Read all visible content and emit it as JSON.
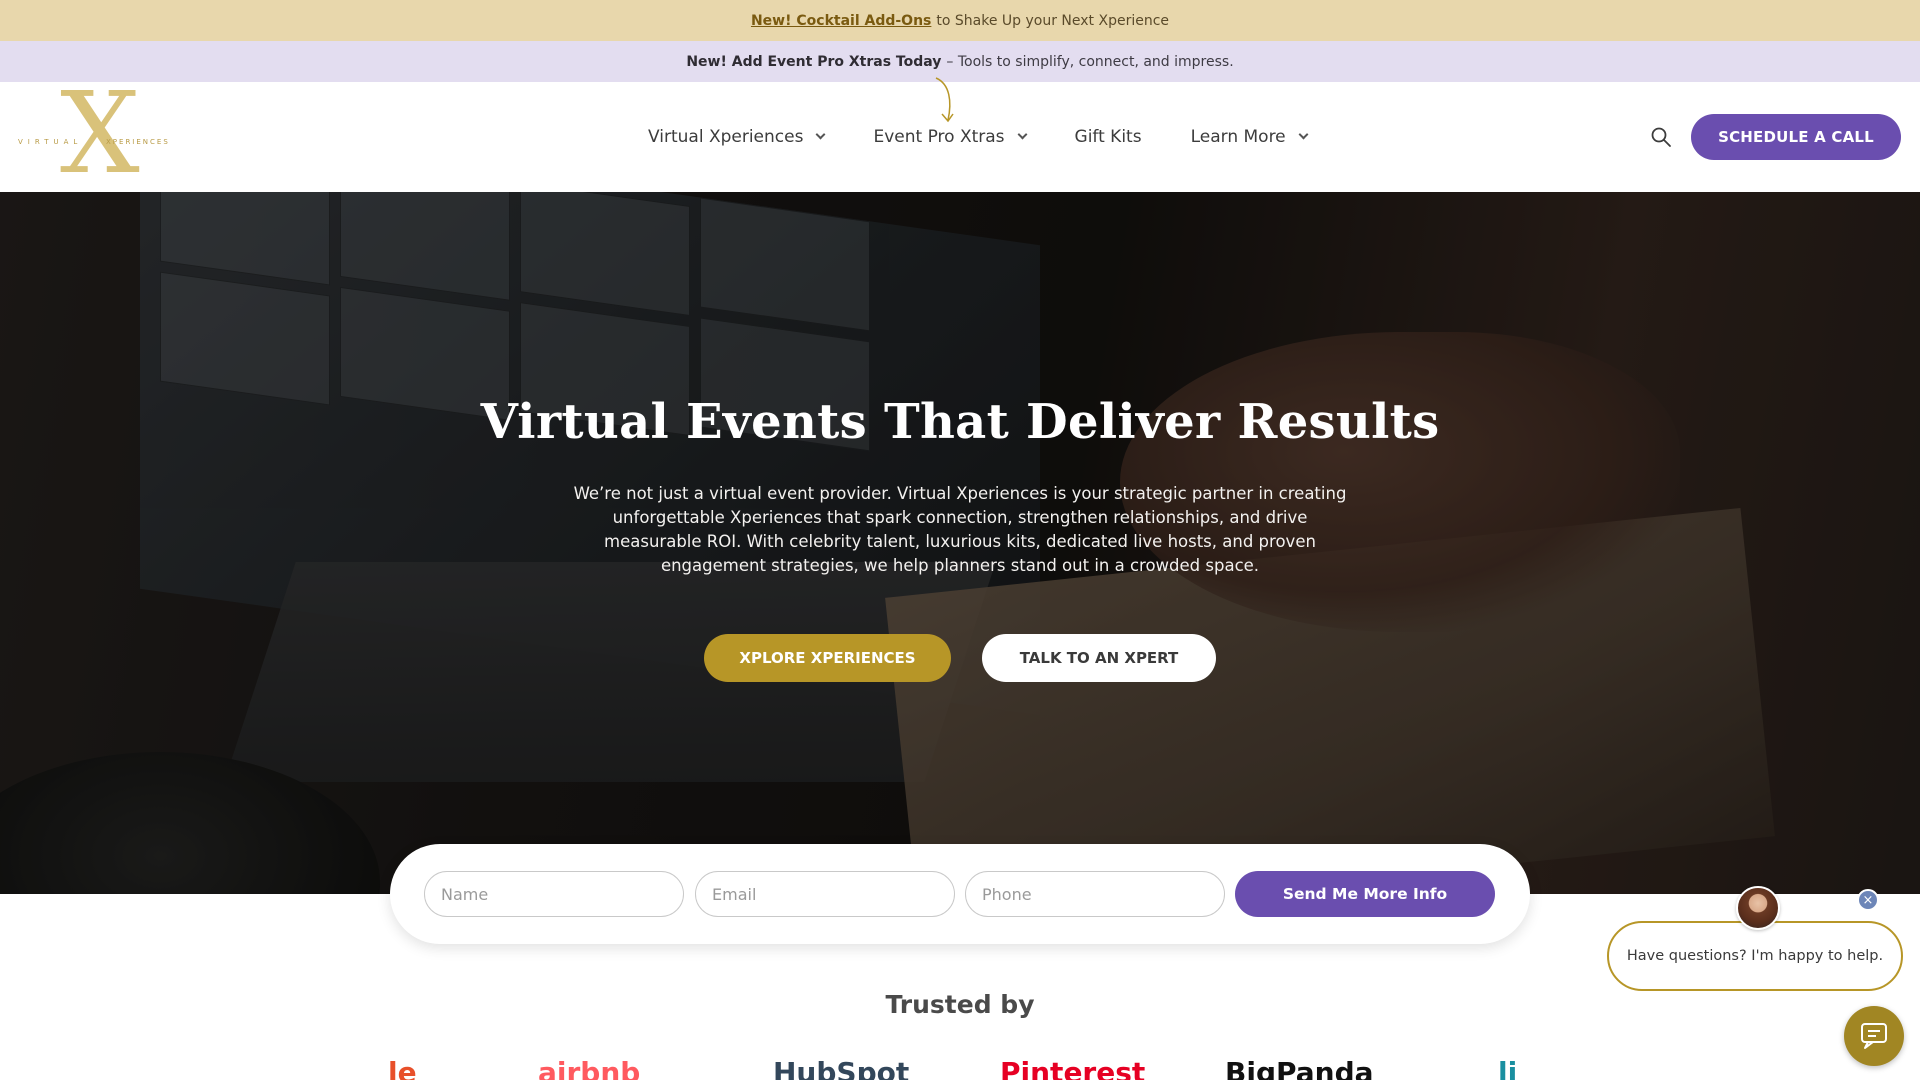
{
  "promo_top": {
    "link": "New! Cocktail Add-Ons",
    "text": "to Shake Up your Next Xperience"
  },
  "promo_second": {
    "bold": "New! Add Event Pro Xtras Today",
    "text": "– Tools to simplify, connect, and impress."
  },
  "logo": {
    "left": "VIRTUAL",
    "right": "XPERIENCES",
    "letter": "X"
  },
  "nav": {
    "items": [
      {
        "label": "Virtual Xperiences",
        "dropdown": true
      },
      {
        "label": "Event Pro Xtras",
        "dropdown": true
      },
      {
        "label": "Gift Kits",
        "dropdown": false
      },
      {
        "label": "Learn More",
        "dropdown": true
      }
    ],
    "cta": "SCHEDULE A CALL",
    "search_icon": "search-icon"
  },
  "hero": {
    "title": "Virtual Events That Deliver Results",
    "text": "We’re not just a virtual event provider. Virtual Xperiences is your strategic partner in creating unforgettable Xperiences that spark connection, strengthen relationships, and drive measurable ROI. With celebrity talent, luxurious kits, dedicated live hosts, and proven engagement strategies, we help planners stand out in a crowded space.",
    "primary_button": "XPLORE XPERIENCES",
    "secondary_button": "TALK TO AN XPERT"
  },
  "form": {
    "name_placeholder": "Name",
    "email_placeholder": "Email",
    "phone_placeholder": "Phone",
    "submit": "Send Me More Info"
  },
  "trusted": {
    "heading": "Trusted by",
    "logos": [
      "le",
      "airbnb",
      "HubSpot",
      "Pinterest",
      "BigPanda",
      "li"
    ]
  },
  "chat": {
    "message": "Have questions? I'm happy to help.",
    "close": "×"
  },
  "colors": {
    "promo_top_bg": "#e8d7ac",
    "promo_second_bg": "#e3ddf0",
    "purple": "#6a4eaf",
    "gold": "#b79627",
    "airbnb": "#ff5a5f",
    "hubspot": "#33475b",
    "pinterest": "#e60023"
  }
}
